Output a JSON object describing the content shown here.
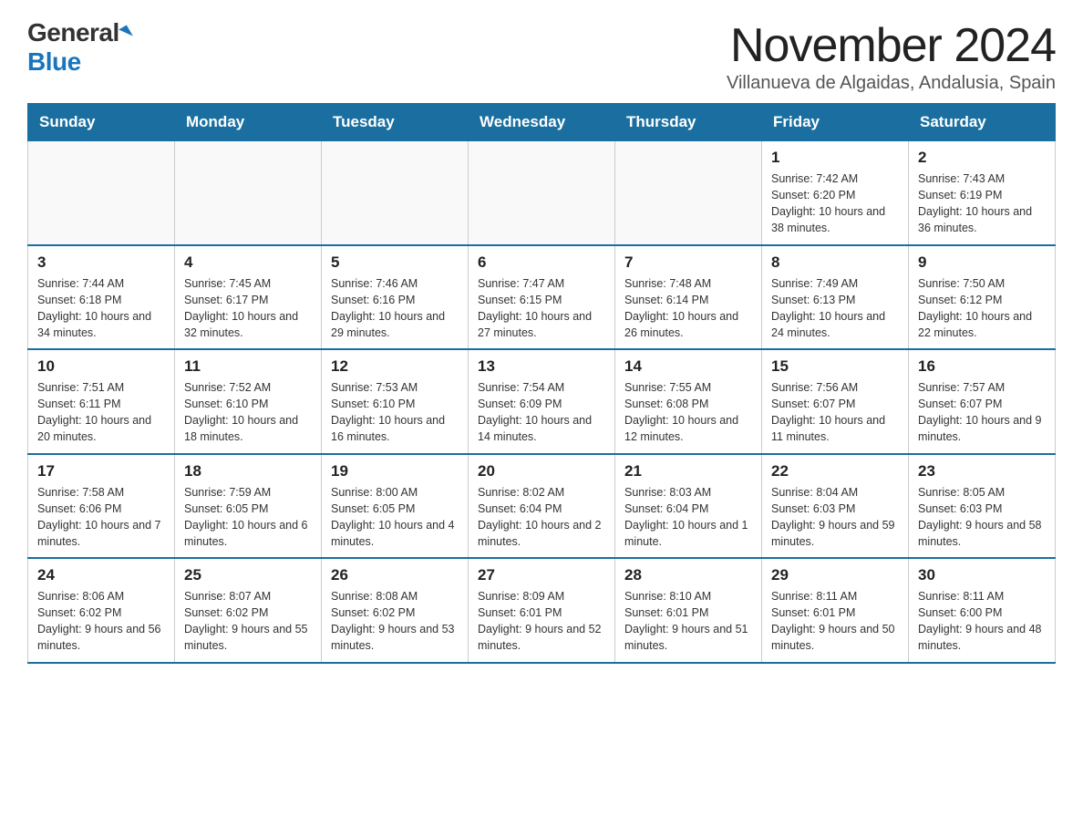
{
  "logo": {
    "general": "General",
    "blue": "Blue"
  },
  "title": "November 2024",
  "subtitle": "Villanueva de Algaidas, Andalusia, Spain",
  "days_of_week": [
    "Sunday",
    "Monday",
    "Tuesday",
    "Wednesday",
    "Thursday",
    "Friday",
    "Saturday"
  ],
  "weeks": [
    [
      {
        "day": "",
        "info": ""
      },
      {
        "day": "",
        "info": ""
      },
      {
        "day": "",
        "info": ""
      },
      {
        "day": "",
        "info": ""
      },
      {
        "day": "",
        "info": ""
      },
      {
        "day": "1",
        "info": "Sunrise: 7:42 AM\nSunset: 6:20 PM\nDaylight: 10 hours and 38 minutes."
      },
      {
        "day": "2",
        "info": "Sunrise: 7:43 AM\nSunset: 6:19 PM\nDaylight: 10 hours and 36 minutes."
      }
    ],
    [
      {
        "day": "3",
        "info": "Sunrise: 7:44 AM\nSunset: 6:18 PM\nDaylight: 10 hours and 34 minutes."
      },
      {
        "day": "4",
        "info": "Sunrise: 7:45 AM\nSunset: 6:17 PM\nDaylight: 10 hours and 32 minutes."
      },
      {
        "day": "5",
        "info": "Sunrise: 7:46 AM\nSunset: 6:16 PM\nDaylight: 10 hours and 29 minutes."
      },
      {
        "day": "6",
        "info": "Sunrise: 7:47 AM\nSunset: 6:15 PM\nDaylight: 10 hours and 27 minutes."
      },
      {
        "day": "7",
        "info": "Sunrise: 7:48 AM\nSunset: 6:14 PM\nDaylight: 10 hours and 26 minutes."
      },
      {
        "day": "8",
        "info": "Sunrise: 7:49 AM\nSunset: 6:13 PM\nDaylight: 10 hours and 24 minutes."
      },
      {
        "day": "9",
        "info": "Sunrise: 7:50 AM\nSunset: 6:12 PM\nDaylight: 10 hours and 22 minutes."
      }
    ],
    [
      {
        "day": "10",
        "info": "Sunrise: 7:51 AM\nSunset: 6:11 PM\nDaylight: 10 hours and 20 minutes."
      },
      {
        "day": "11",
        "info": "Sunrise: 7:52 AM\nSunset: 6:10 PM\nDaylight: 10 hours and 18 minutes."
      },
      {
        "day": "12",
        "info": "Sunrise: 7:53 AM\nSunset: 6:10 PM\nDaylight: 10 hours and 16 minutes."
      },
      {
        "day": "13",
        "info": "Sunrise: 7:54 AM\nSunset: 6:09 PM\nDaylight: 10 hours and 14 minutes."
      },
      {
        "day": "14",
        "info": "Sunrise: 7:55 AM\nSunset: 6:08 PM\nDaylight: 10 hours and 12 minutes."
      },
      {
        "day": "15",
        "info": "Sunrise: 7:56 AM\nSunset: 6:07 PM\nDaylight: 10 hours and 11 minutes."
      },
      {
        "day": "16",
        "info": "Sunrise: 7:57 AM\nSunset: 6:07 PM\nDaylight: 10 hours and 9 minutes."
      }
    ],
    [
      {
        "day": "17",
        "info": "Sunrise: 7:58 AM\nSunset: 6:06 PM\nDaylight: 10 hours and 7 minutes."
      },
      {
        "day": "18",
        "info": "Sunrise: 7:59 AM\nSunset: 6:05 PM\nDaylight: 10 hours and 6 minutes."
      },
      {
        "day": "19",
        "info": "Sunrise: 8:00 AM\nSunset: 6:05 PM\nDaylight: 10 hours and 4 minutes."
      },
      {
        "day": "20",
        "info": "Sunrise: 8:02 AM\nSunset: 6:04 PM\nDaylight: 10 hours and 2 minutes."
      },
      {
        "day": "21",
        "info": "Sunrise: 8:03 AM\nSunset: 6:04 PM\nDaylight: 10 hours and 1 minute."
      },
      {
        "day": "22",
        "info": "Sunrise: 8:04 AM\nSunset: 6:03 PM\nDaylight: 9 hours and 59 minutes."
      },
      {
        "day": "23",
        "info": "Sunrise: 8:05 AM\nSunset: 6:03 PM\nDaylight: 9 hours and 58 minutes."
      }
    ],
    [
      {
        "day": "24",
        "info": "Sunrise: 8:06 AM\nSunset: 6:02 PM\nDaylight: 9 hours and 56 minutes."
      },
      {
        "day": "25",
        "info": "Sunrise: 8:07 AM\nSunset: 6:02 PM\nDaylight: 9 hours and 55 minutes."
      },
      {
        "day": "26",
        "info": "Sunrise: 8:08 AM\nSunset: 6:02 PM\nDaylight: 9 hours and 53 minutes."
      },
      {
        "day": "27",
        "info": "Sunrise: 8:09 AM\nSunset: 6:01 PM\nDaylight: 9 hours and 52 minutes."
      },
      {
        "day": "28",
        "info": "Sunrise: 8:10 AM\nSunset: 6:01 PM\nDaylight: 9 hours and 51 minutes."
      },
      {
        "day": "29",
        "info": "Sunrise: 8:11 AM\nSunset: 6:01 PM\nDaylight: 9 hours and 50 minutes."
      },
      {
        "day": "30",
        "info": "Sunrise: 8:11 AM\nSunset: 6:00 PM\nDaylight: 9 hours and 48 minutes."
      }
    ]
  ]
}
